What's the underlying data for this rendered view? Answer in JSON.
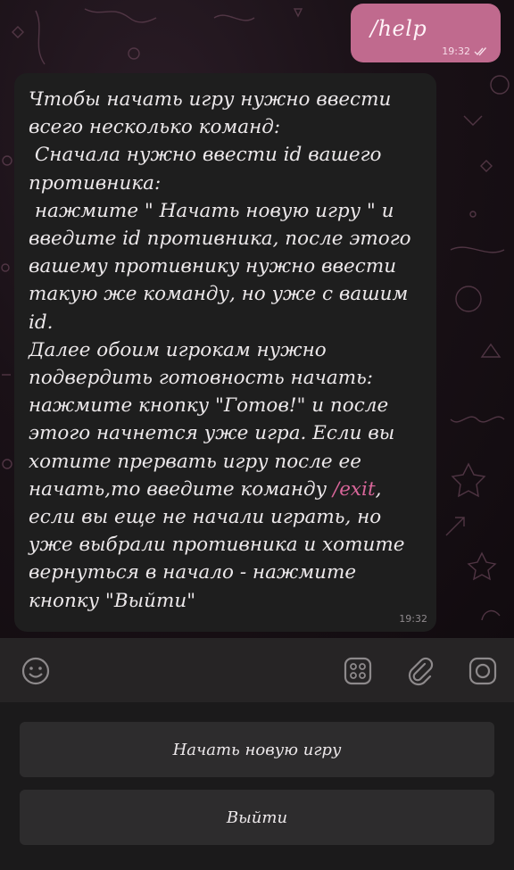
{
  "chat": {
    "outgoing": {
      "text": "/help",
      "time": "19:32",
      "status_icon": "double-check-icon"
    },
    "incoming": {
      "text_before_cmd": "Чтобы начать игру нужно ввести всего несколько команд:\n Сначала нужно ввести id вашего противника:\n нажмите \" Начать новую игру \" и введите id противника, после этого вашему противнику нужно ввести такую же команду, но уже с вашим id.\nДалее обоим игрокам нужно подвердить готовность начать: нажмите кнопку \"Готов!\" и после этого начнется уже игра. Если вы хотите прервать игру после ее начать,то введите команду ",
      "cmd": "/exit",
      "text_after_cmd": ", если вы еще не начали играть, но уже выбрали противника и хотите вернуться в начало - нажмите кнопку \"Выйти\"",
      "time": "19:32"
    }
  },
  "input_bar": {
    "emoji_icon": "emoji-icon",
    "sticker_icon": "bot-keyboard-icon",
    "attach_icon": "paperclip-icon",
    "camera_icon": "camera-icon"
  },
  "keyboard": {
    "buttons": [
      {
        "label": "Начать новую игру"
      },
      {
        "label": "Выйти"
      }
    ]
  },
  "colors": {
    "outgoing_bubble": "#c06a8e",
    "incoming_bubble": "#1e1e1e",
    "command_link": "#d9669a"
  }
}
